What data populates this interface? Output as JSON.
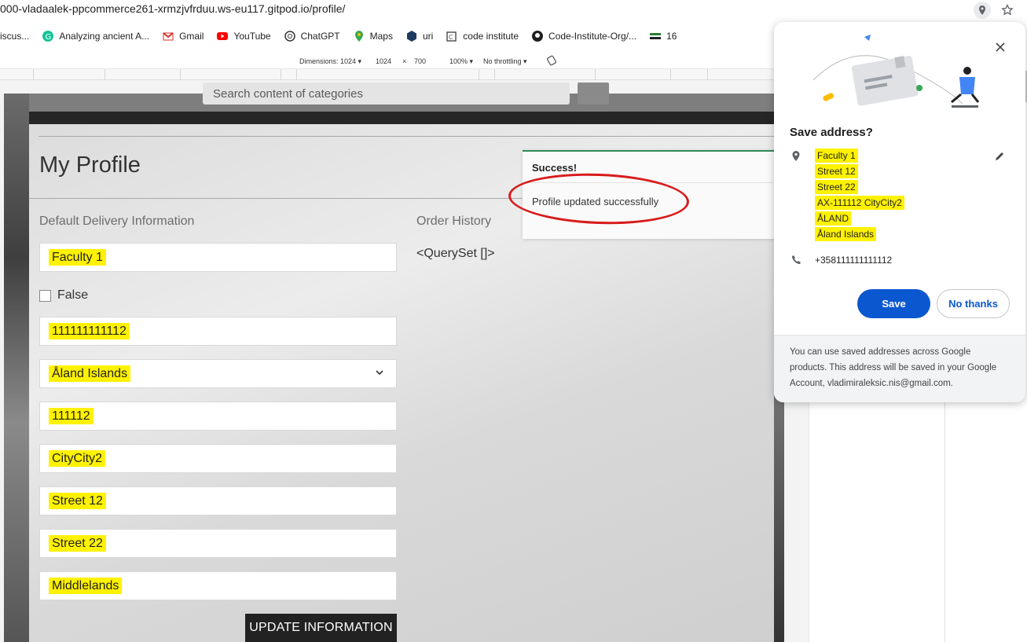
{
  "browser": {
    "url": "000-vladaalek-ppcommerce261-xrmzjvfrduu.ws-eu117.gitpod.io/profile/",
    "bookmarks": [
      {
        "label": "iscus...",
        "icon": "folder-icon"
      },
      {
        "label": "Analyzing ancient A...",
        "icon": "grammarly-icon"
      },
      {
        "label": "Gmail",
        "icon": "gmail-icon"
      },
      {
        "label": "YouTube",
        "icon": "youtube-icon"
      },
      {
        "label": "ChatGPT",
        "icon": "chatgpt-icon"
      },
      {
        "label": "Maps",
        "icon": "maps-icon"
      },
      {
        "label": "uri",
        "icon": "uri-icon"
      },
      {
        "label": "code institute",
        "icon": "code-institute-icon"
      },
      {
        "label": "Code-Institute-Org/...",
        "icon": "github-icon"
      },
      {
        "label": "16",
        "icon": "flag-icon"
      }
    ]
  },
  "devtools": {
    "dimensions_label": "Dimensions: 1024 ▾",
    "width": "1024",
    "times": "×",
    "height": "700",
    "zoom": "100% ▾",
    "throttling": "No throttling ▾"
  },
  "site": {
    "search_placeholder": "Search content of categories"
  },
  "profile": {
    "title": "My Profile",
    "delivery_heading": "Default Delivery Information",
    "order_heading": "Order History",
    "queryset": "<QuerySet []>",
    "fields": {
      "full_name": "Faculty 1",
      "checkbox_label": "False",
      "phone": "111111111112",
      "country": "Åland Islands",
      "postcode": "111112",
      "town": "CityCity2",
      "street1": "Street 12",
      "street2": "Street 22",
      "county": "Middlelands"
    },
    "update_button": "UPDATE INFORMATION"
  },
  "toast": {
    "title": "Success!",
    "message": "Profile updated successfully"
  },
  "save_address_popup": {
    "title": "Save address?",
    "address_lines": [
      "Faculty 1",
      "Street 12",
      "Street 22",
      "AX-111112 CityCity2",
      "ÅLAND",
      "Åland Islands"
    ],
    "phone": "+358111111111112",
    "save_label": "Save",
    "no_thanks_label": "No thanks",
    "footer": "You can use saved addresses across Google products. This address will be saved in your Google Account, vladimiraleksic.nis@gmail.com."
  },
  "colors": {
    "highlight": "#fff200",
    "google_blue": "#0b57d0",
    "annotation_red": "#d81b1b",
    "toast_accent": "#2e8b57"
  }
}
